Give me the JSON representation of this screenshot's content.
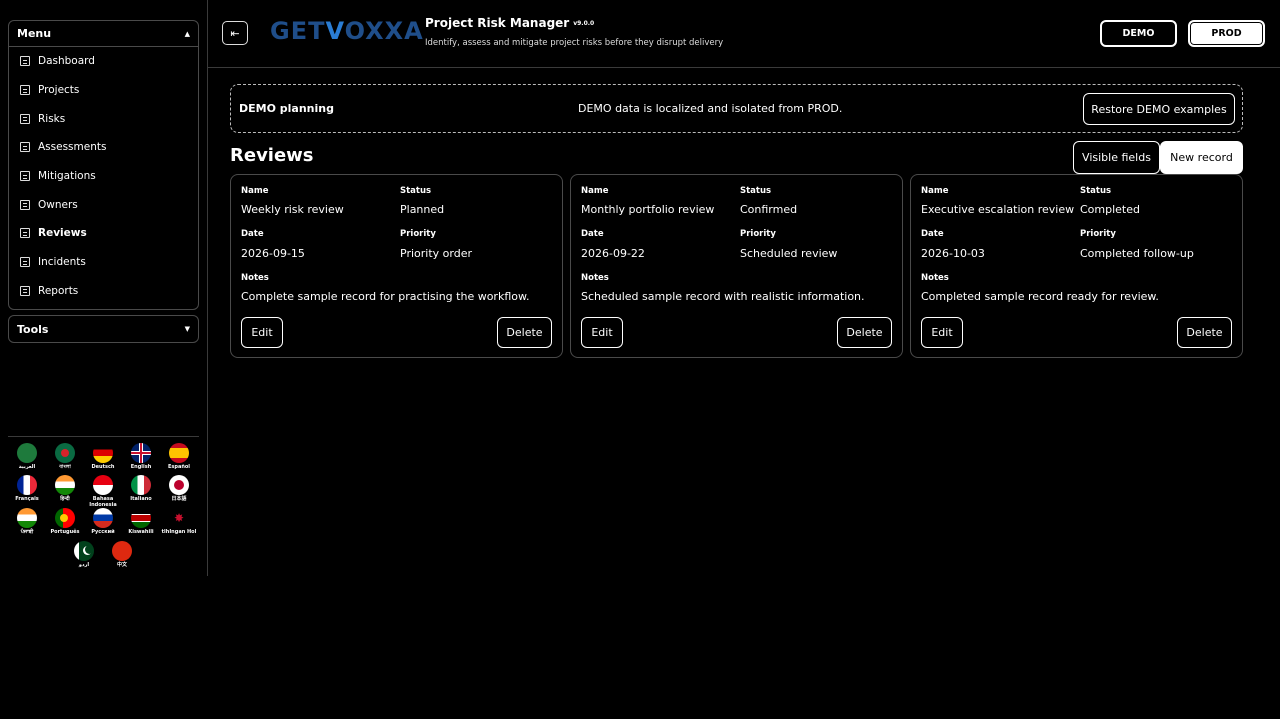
{
  "sidebar": {
    "menu_title": "Menu",
    "items": [
      {
        "label": "Dashboard",
        "active": false
      },
      {
        "label": "Projects",
        "active": false
      },
      {
        "label": "Risks",
        "active": false
      },
      {
        "label": "Assessments",
        "active": false
      },
      {
        "label": "Mitigations",
        "active": false
      },
      {
        "label": "Owners",
        "active": false
      },
      {
        "label": "Reviews",
        "active": true
      },
      {
        "label": "Incidents",
        "active": false
      },
      {
        "label": "Reports",
        "active": false
      }
    ],
    "tools_title": "Tools",
    "languages": [
      "العربية",
      "বাংলা",
      "Deutsch",
      "English",
      "Español",
      "Français",
      "हिन्दी",
      "Bahasa Indonesia",
      "Italiano",
      "日本語",
      "ਪੰਜਾਬੀ",
      "Português",
      "Русский",
      "Kiswahili",
      "tlhIngan Hol",
      "اردو",
      "中文"
    ]
  },
  "header": {
    "logo_pre": "GET",
    "logo_v": "V",
    "logo_post": "OXXA",
    "title": "Project Risk Manager",
    "version": "v9.0.0",
    "subtitle": "Identify, assess and mitigate project risks before they disrupt delivery",
    "demo_label": "DEMO",
    "prod_label": "PROD"
  },
  "banner": {
    "title": "DEMO planning",
    "message": "DEMO data is localized and isolated from PROD.",
    "restore_label": "Restore DEMO examples"
  },
  "section": {
    "title": "Reviews",
    "visible_fields_label": "Visible fields",
    "new_record_label": "New record"
  },
  "labels": {
    "name": "Name",
    "status": "Status",
    "date": "Date",
    "priority": "Priority",
    "notes": "Notes",
    "edit": "Edit",
    "delete": "Delete"
  },
  "records": [
    {
      "name": "Weekly risk review",
      "status": "Planned",
      "date": "2026-09-15",
      "priority": "Priority order",
      "notes": "Complete sample record for practising the workflow."
    },
    {
      "name": "Monthly portfolio review",
      "status": "Confirmed",
      "date": "2026-09-22",
      "priority": "Scheduled review",
      "notes": "Scheduled sample record with realistic information."
    },
    {
      "name": "Executive escalation review",
      "status": "Completed",
      "date": "2026-10-03",
      "priority": "Completed follow-up",
      "notes": "Completed sample record ready for review."
    }
  ]
}
